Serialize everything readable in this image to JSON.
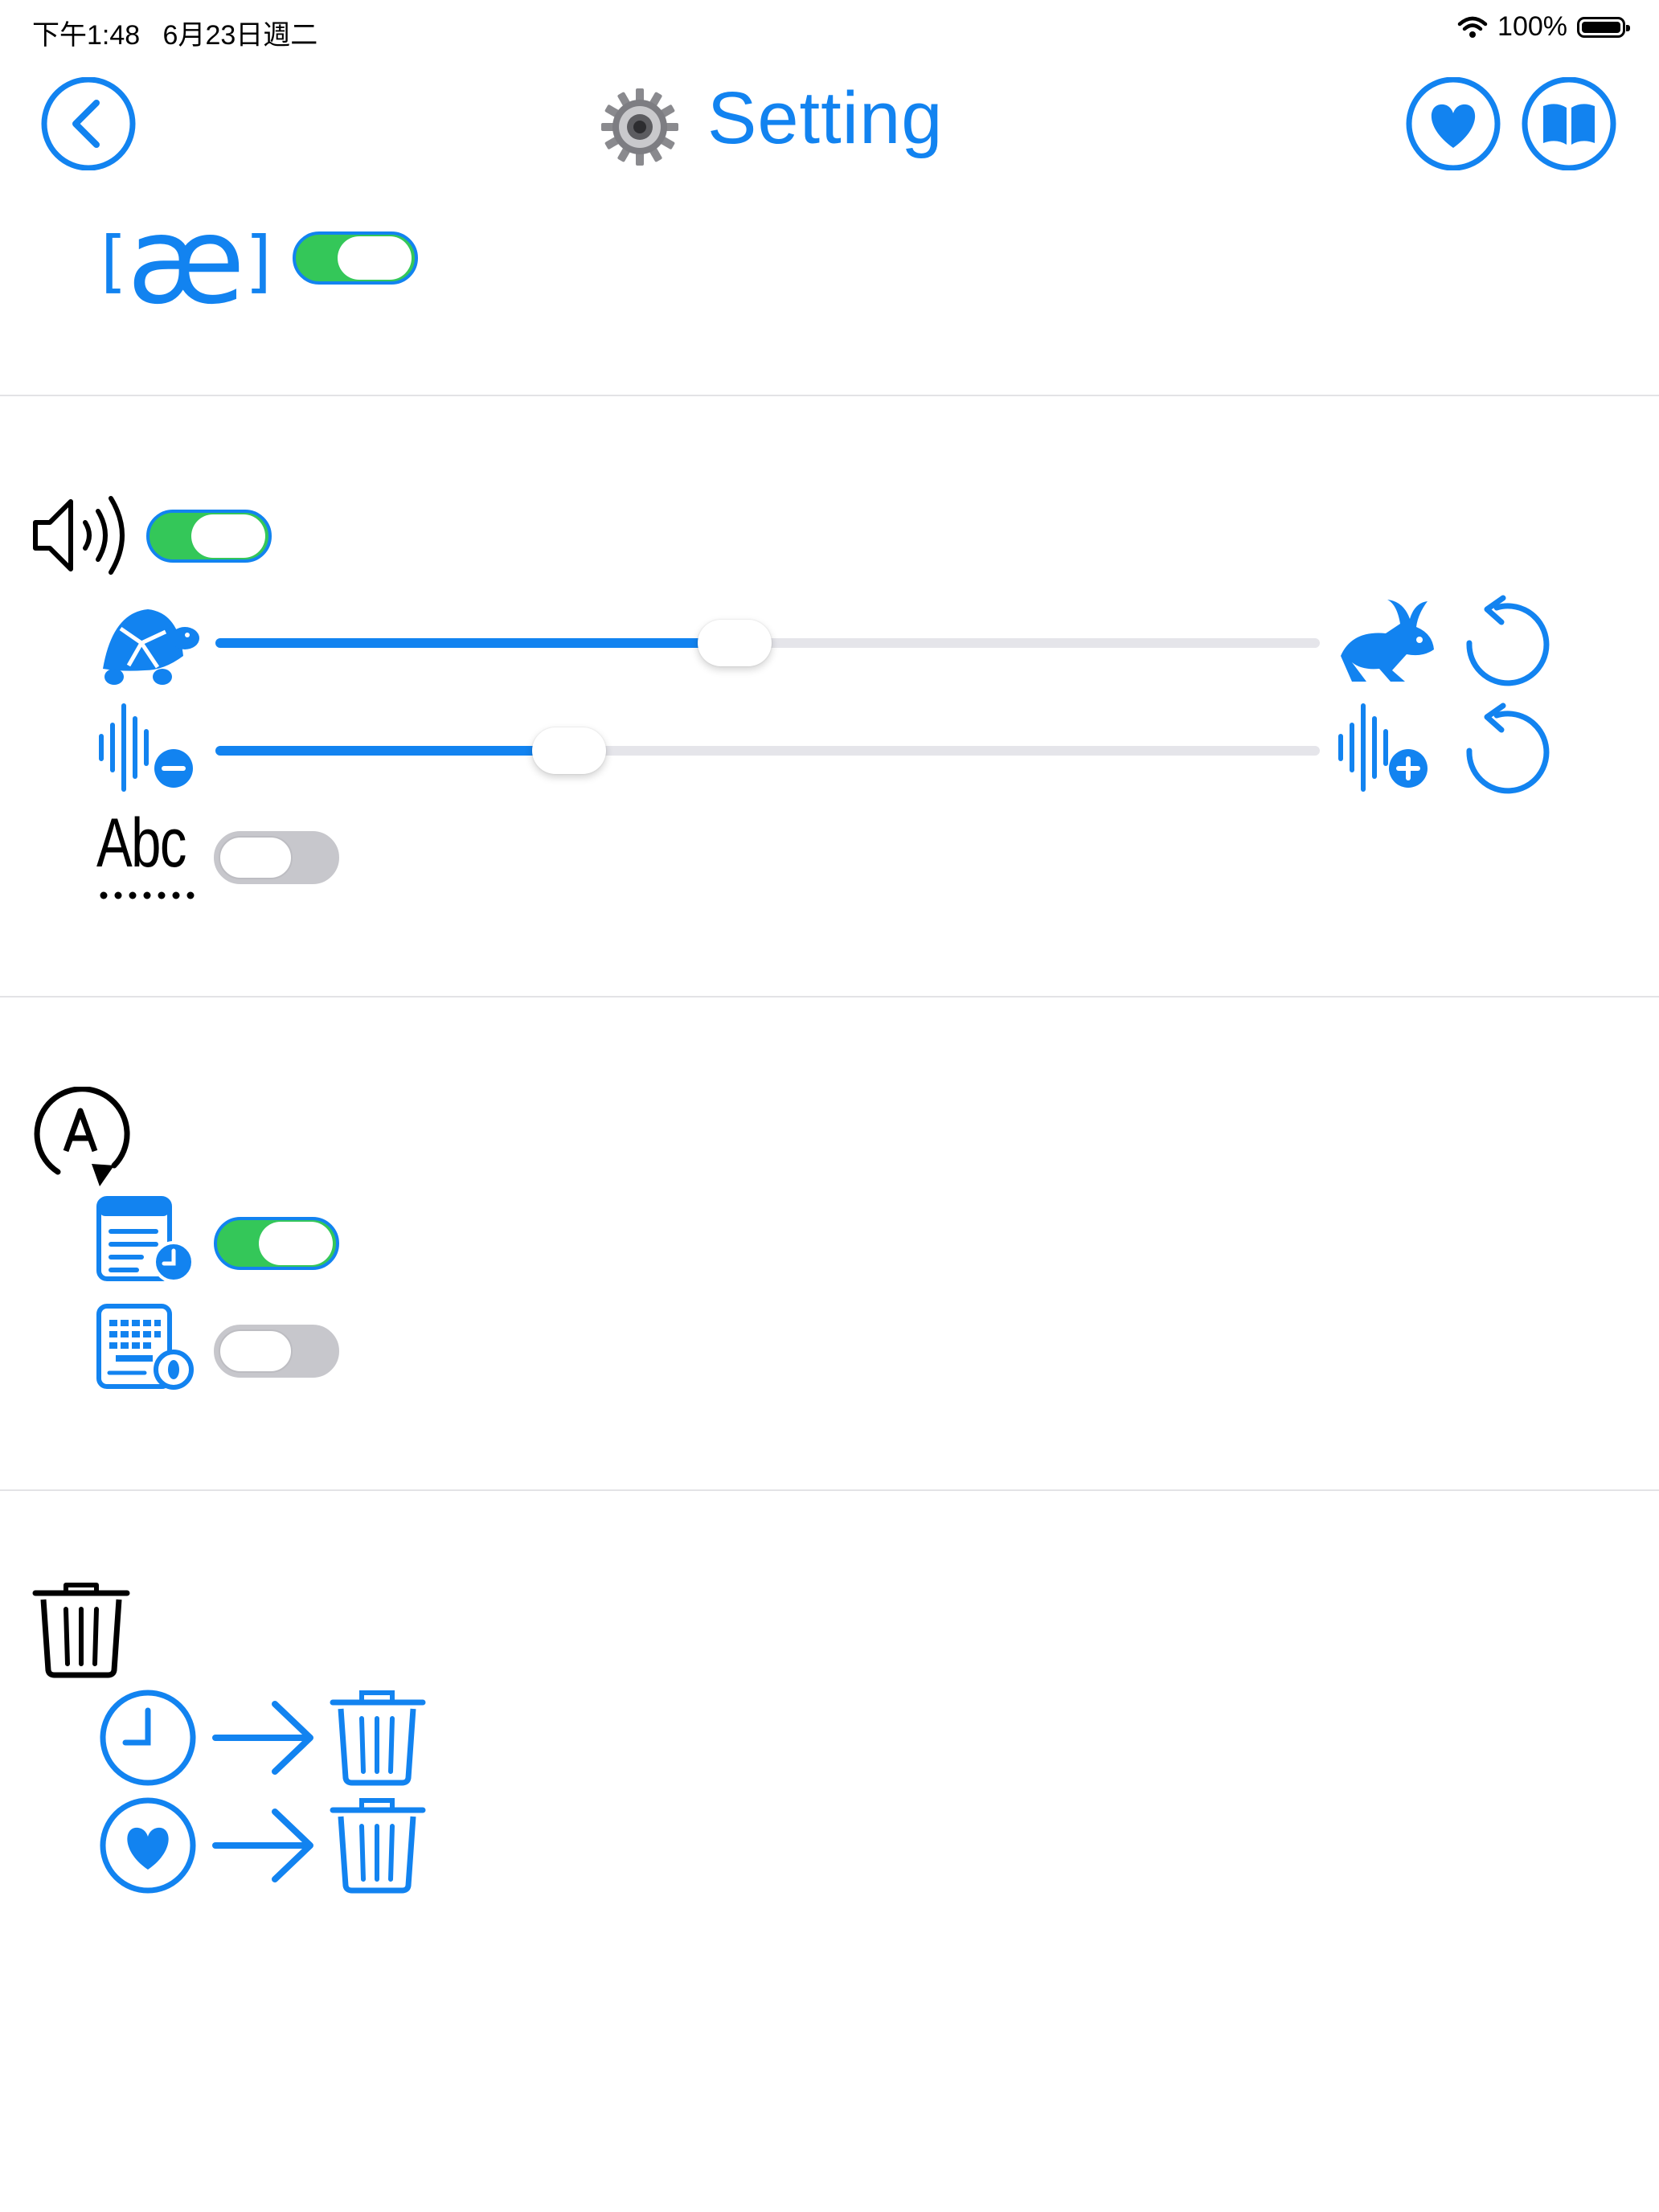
{
  "status_bar": {
    "time": "下午1:48",
    "date": "6月23日週二",
    "battery": "100%"
  },
  "header": {
    "title": "Setting"
  },
  "phonetic": {
    "symbol": "æ",
    "bracket_left": "[",
    "bracket_right": "]",
    "enabled": true
  },
  "audio": {
    "enabled": true,
    "speed_fraction": 0.47,
    "volume_fraction": 0.32,
    "text_label": "Abc",
    "text_enabled": false
  },
  "auto": {
    "schedule_enabled": true,
    "keyboard_enabled": false
  },
  "colors": {
    "accent": "#1283F0",
    "toggle_on": "#34C759",
    "toggle_off": "#C7C7CC"
  }
}
